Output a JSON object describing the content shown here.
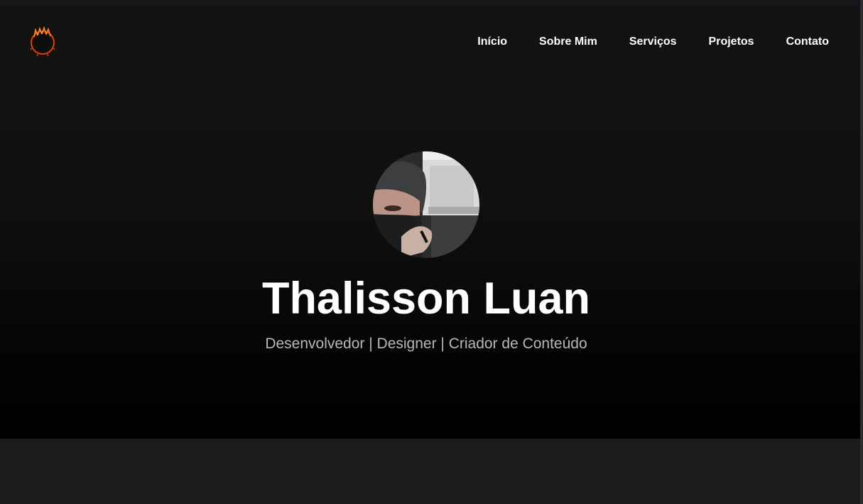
{
  "nav": {
    "logo_icon": "flaming-ring-logo-icon",
    "items": [
      {
        "label": "Início"
      },
      {
        "label": "Sobre Mim"
      },
      {
        "label": "Serviços"
      },
      {
        "label": "Projetos"
      },
      {
        "label": "Contato"
      }
    ]
  },
  "hero": {
    "avatar_icon": "profile-photo",
    "name": "Thalisson Luan",
    "tagline": "Desenvolvedor | Designer | Criador de Conteúdo"
  },
  "colors": {
    "background": "#121212",
    "text": "#ffffff",
    "tagline": "#b8b8b8",
    "section_below": "#1b1b1b"
  }
}
